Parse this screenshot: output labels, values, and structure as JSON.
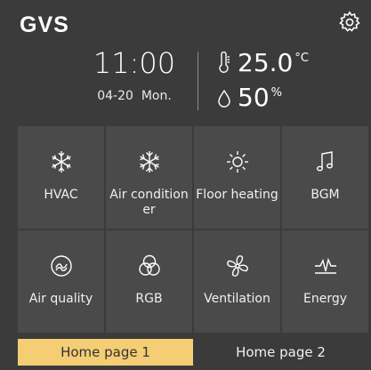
{
  "brand": {
    "logo_text": "GVS"
  },
  "header": {
    "time": "11:00",
    "date": "04-20",
    "weekday": "Mon.",
    "temperature": "25.0",
    "temperature_unit": "°C",
    "humidity": "50",
    "humidity_unit": "%"
  },
  "tiles": [
    {
      "label": "HVAC",
      "icon": "hvac-icon"
    },
    {
      "label": "Air conditioner",
      "icon": "snowflake-icon"
    },
    {
      "label": "Floor heating",
      "icon": "sun-icon"
    },
    {
      "label": "BGM",
      "icon": "music-note-icon"
    },
    {
      "label": "Air quality",
      "icon": "air-quality-icon"
    },
    {
      "label": "RGB",
      "icon": "rgb-icon"
    },
    {
      "label": "Ventilation",
      "icon": "fan-icon"
    },
    {
      "label": "Energy",
      "icon": "energy-icon"
    }
  ],
  "tabs": [
    {
      "label": "Home page 1",
      "active": true
    },
    {
      "label": "Home page 2",
      "active": false
    }
  ],
  "colors": {
    "background": "#3b3b3b",
    "tile": "#4a4a4a",
    "active_tab": "#f4cd75"
  }
}
